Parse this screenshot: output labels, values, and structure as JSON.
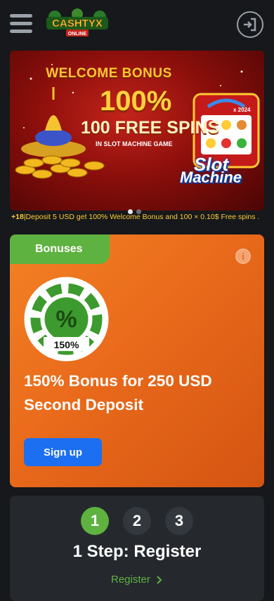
{
  "header": {
    "logo_text_top": "CASHTYX",
    "logo_text_bottom": "ONLINE"
  },
  "banner": {
    "headline": "WELCOME BONUS",
    "percent": "100%",
    "free_spins": "100 FREE SPINS",
    "subline": "IN SLOT MACHINE GAME",
    "game_word1": "Slot",
    "game_word2": "Machine",
    "multiplier": "x 2024",
    "active_slide": 1,
    "slide_count": 2
  },
  "promo_line": {
    "age": "+18",
    "text": "|Deposit 5 USD get 100% Welcome Bonus and 100 × 0.10$ Free spins ."
  },
  "bonus_card": {
    "tab_label": "Bonuses",
    "info_symbol": "i",
    "chip_symbol": "%",
    "chip_percent": "150%",
    "title": "150% Bonus for 250 USD Second Deposit",
    "signup_label": "Sign up"
  },
  "steps": {
    "items": [
      "1",
      "2",
      "3"
    ],
    "active_step": 1,
    "title": "1 Step: Register",
    "link_label": "Register"
  },
  "colors": {
    "accent_green": "#5eb23f",
    "card_orange": "#e96a1b",
    "button_blue": "#1c6ff0",
    "background": "#16181b"
  },
  "icons": [
    "menu-icon",
    "login-icon",
    "info-icon",
    "percent-chip-icon",
    "chevron-right-icon"
  ]
}
